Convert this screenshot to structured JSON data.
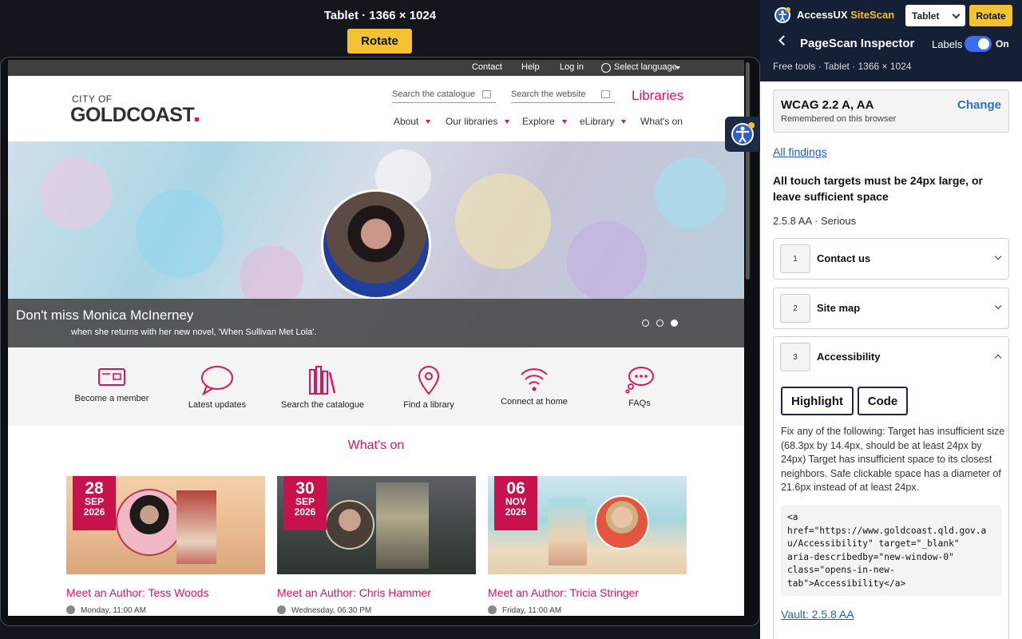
{
  "device_bar": {
    "title": "Tablet · 1366 × 1024",
    "rotate_label": "Rotate"
  },
  "site": {
    "util_links": [
      "Contact",
      "Help",
      "Log in",
      "Select language"
    ],
    "logo_line1": "CITY OF",
    "logo_line2": "GOLDCOAST",
    "search_catalogue_placeholder": "Search the catalogue",
    "search_website_placeholder": "Search the website",
    "section_title": "Libraries",
    "nav": [
      "About",
      "Our libraries",
      "Explore",
      "eLibrary",
      "What's on"
    ],
    "hero": {
      "title": "Don't miss Monica McInerney",
      "subtitle": "when she returns with her new novel, 'When Sullivan Met Lola'.",
      "slide_count": 3,
      "active_slide": 3
    },
    "quick_links": [
      "Become a member",
      "Latest updates",
      "Search the catalogue",
      "Find a library",
      "Connect at home",
      "FAQs"
    ],
    "whats_on_heading": "What's on",
    "events": [
      {
        "day": "28",
        "month": "SEP",
        "year": "2026",
        "title": "Meet an Author: Tess Woods",
        "time": "Monday, 11:00 AM"
      },
      {
        "day": "30",
        "month": "SEP",
        "year": "2026",
        "title": "Meet an Author: Chris Hammer",
        "time": "Wednesday, 06:30 PM"
      },
      {
        "day": "06",
        "month": "NOV",
        "year": "2026",
        "title": "Meet an Author: Tricia Stringer",
        "time": "Friday, 11:00 AM"
      }
    ]
  },
  "panel": {
    "brand_prefix": "AccessUX ",
    "brand_name": "SiteScan",
    "device_select": "Tablet",
    "rotate_label": "Rotate",
    "title": "PageScan Inspector",
    "labels_text": "Labels",
    "toggle_state": "On",
    "meta": "Free tools · Tablet · 1366 × 1024",
    "standard": {
      "title": "WCAG 2.2 A, AA",
      "subtitle": "Remembered on this browser",
      "change_label": "Change"
    },
    "all_findings": "All findings",
    "rule_title": "All touch targets must be 24px large, or leave sufficient space",
    "severity": "2.5.8 AA · Serious",
    "items": [
      {
        "num": "1",
        "label": "Contact us"
      },
      {
        "num": "2",
        "label": "Site map"
      },
      {
        "num": "3",
        "label": "Accessibility"
      }
    ],
    "highlight_label": "Highlight",
    "code_label": "Code",
    "fix_text": "Fix any of the following: Target has insufficient size (68.3px by 14.4px, should be at least 24px by 24px) Target has insufficient space to its closest neighbors. Safe clickable space has a diameter of 21.6px instead of at least 24px.",
    "code_snippet": "<a\nhref=\"https://www.goldcoast.qld.gov.a\nu/Accessibility\" target=\"_blank\"\naria-describedby=\"new-window-0\"\nclass=\"opens-in-new-\ntab\">Accessibility</a>",
    "vault_link": "Vault: 2.5.8 AA"
  },
  "colors": {
    "brand_pink": "#e0125a",
    "accent_yellow": "#f2c230",
    "panel_navy": "#152036",
    "link_blue": "#1d5fd0"
  }
}
